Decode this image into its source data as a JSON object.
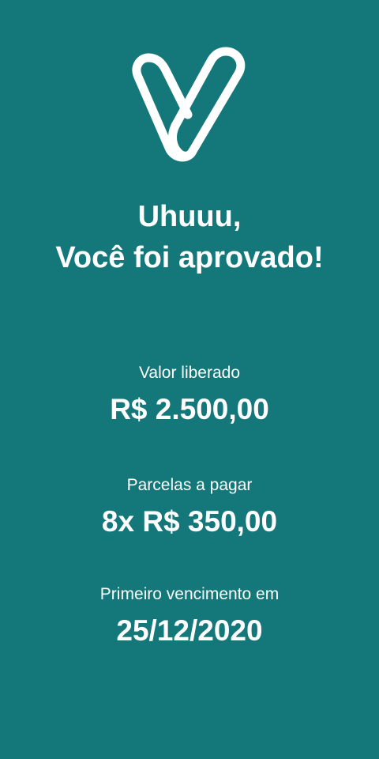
{
  "brand": {
    "logo_icon": "v-logo-icon",
    "background_color": "#14787A",
    "foreground_color": "#FFFFFF"
  },
  "headline": {
    "line1": "Uhuuu,",
    "line2": "Você foi aprovado!"
  },
  "details": [
    {
      "label": "Valor liberado",
      "value": "R$ 2.500,00"
    },
    {
      "label": "Parcelas a pagar",
      "value": "8x R$ 350,00"
    },
    {
      "label": "Primeiro vencimento em",
      "value": "25/12/2020"
    }
  ]
}
